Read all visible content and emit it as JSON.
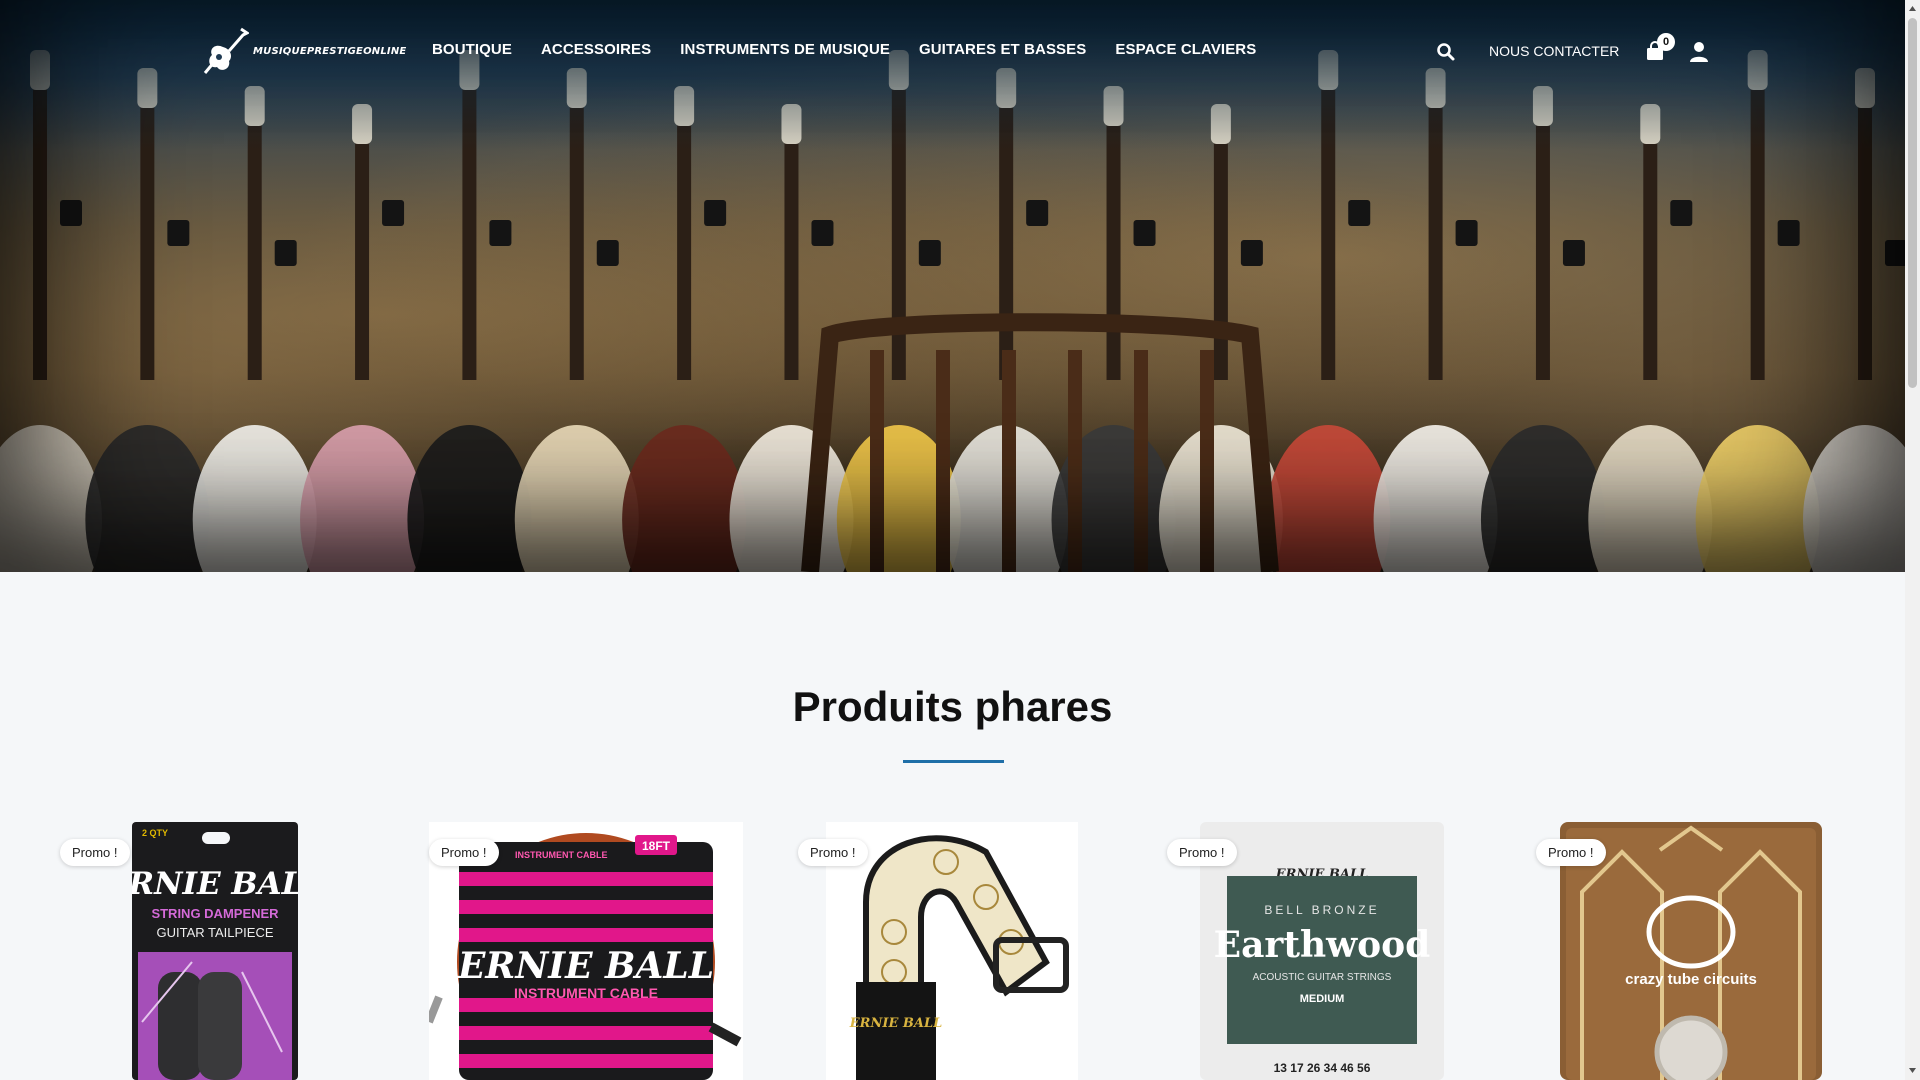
{
  "brand": {
    "logo_text": "MUSIQUEPRESTIGEONLINE"
  },
  "nav": {
    "items": [
      {
        "label": "BOUTIQUE"
      },
      {
        "label": "ACCESSOIRES"
      },
      {
        "label": "INSTRUMENTS DE MUSIQUE"
      },
      {
        "label": "GUITARES ET BASSES"
      },
      {
        "label": "ESPACE CLAVIERS"
      }
    ]
  },
  "header_actions": {
    "search_icon": "search-icon",
    "contact_label": "NOUS CONTACTER",
    "cart_icon": "shopping-bag-icon",
    "cart_count": "0",
    "account_icon": "user-icon"
  },
  "featured": {
    "title": "Produits phares",
    "products": [
      {
        "badge": "Promo !",
        "image_text": [
          "2 QTY",
          "ERNIE BALL",
          "STRING DAMPENER",
          "GUITAR TAILPIECE"
        ]
      },
      {
        "badge": "Promo !",
        "image_text": [
          "INSTRUMENT CABLE",
          "18FT",
          "ERNIE BALL",
          "INSTRUMENT CABLE"
        ]
      },
      {
        "badge": "Promo !",
        "image_text": [
          "ERNIE BALL"
        ]
      },
      {
        "badge": "Promo !",
        "image_text": [
          "ERNIE BALL",
          "BELL BRONZE",
          "Earthwood",
          "ACOUSTIC GUITAR STRINGS",
          "MEDIUM",
          "13 17 26 34 46 56"
        ]
      },
      {
        "badge": "Promo !",
        "image_text": [
          "crazy tube circuits"
        ]
      }
    ]
  },
  "colors": {
    "accent_rule": "#1f6fa8",
    "header_bg": "#0c283e",
    "page_bg": "#f5f7f9"
  }
}
